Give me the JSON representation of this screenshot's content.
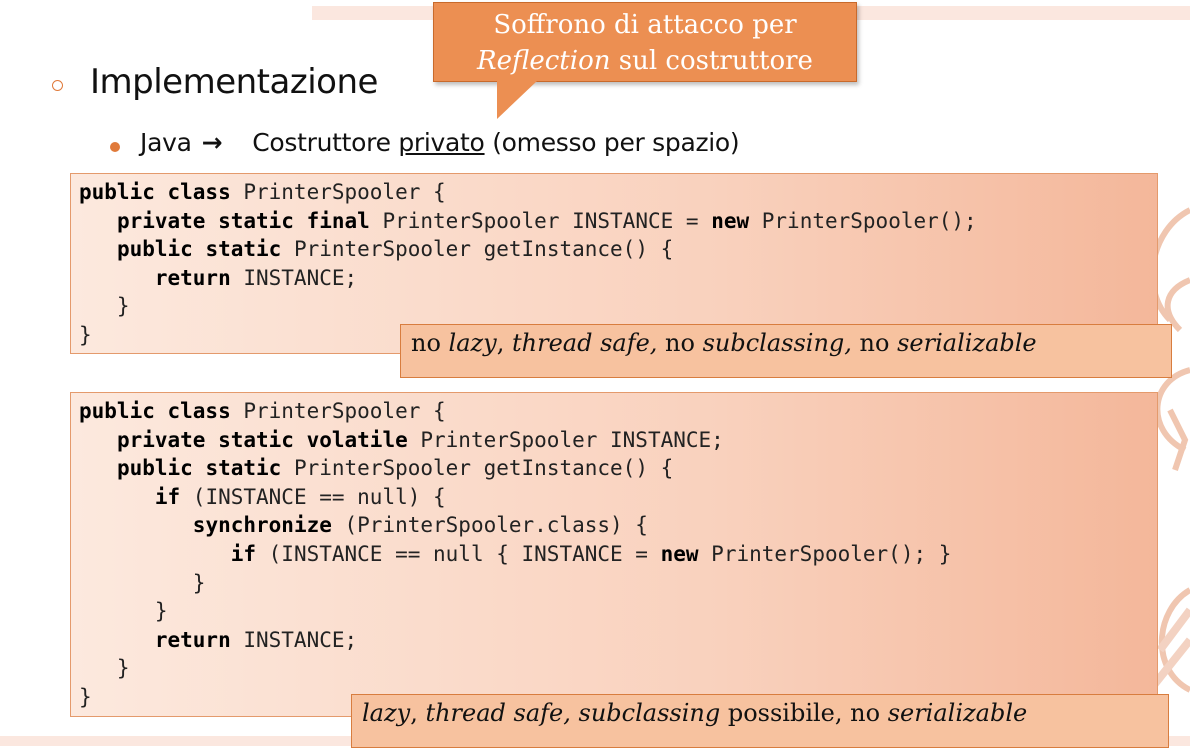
{
  "callout": {
    "line1": "Soffrono di attacco per",
    "line2_italic": "Reflection",
    "line2_rest": " sul costruttore"
  },
  "heading": "Implementazione",
  "subpoint": {
    "lang": "Java",
    "arrow": "→",
    "text_before": "Costruttore ",
    "underlined": "privato",
    "text_after": " (omesso per spazio)"
  },
  "code1": {
    "line1_kw": "public class",
    "line1_rest": " PrinterSpooler {",
    "line2_indent": "   ",
    "line2_kw": "private static final",
    "line2_mid": " PrinterSpooler INSTANCE = ",
    "line2_kw2": "new",
    "line2_rest": " PrinterSpooler();",
    "line3_indent": "   ",
    "line3_kw": "public static",
    "line3_rest": " PrinterSpooler getInstance() {",
    "line4_indent": "      ",
    "line4_kw": "return",
    "line4_rest": " INSTANCE;",
    "line5": "   }",
    "line6": "}"
  },
  "note1": {
    "p1": "no ",
    "i1": "lazy",
    "p2": ", ",
    "i2": "thread safe,",
    "p3": " no ",
    "i3": "subclassing,",
    "p4": " no ",
    "i4": "serializable"
  },
  "code2": {
    "l1_kw": "public class",
    "l1_rest": " PrinterSpooler {",
    "l2_ind": "   ",
    "l2_kw": "private static volatile",
    "l2_rest": " PrinterSpooler INSTANCE;",
    "l3_ind": "   ",
    "l3_kw": "public static",
    "l3_rest": " PrinterSpooler getInstance() {",
    "l4_ind": "      ",
    "l4_kw": "if",
    "l4_rest": " (INSTANCE == null) {",
    "l5_ind": "         ",
    "l5_kw": "synchronize",
    "l5_rest": " (PrinterSpooler.class) {",
    "l6_ind": "            ",
    "l6_kw": "if",
    "l6_mid": " (INSTANCE == null { INSTANCE = ",
    "l6_kw2": "new",
    "l6_rest": " PrinterSpooler(); }",
    "l7": "         }",
    "l8": "      }",
    "l9_ind": "      ",
    "l9_kw": "return",
    "l9_rest": " INSTANCE;",
    "l10": "   }",
    "l11": "}"
  },
  "note2": {
    "i1": "lazy",
    "p1": ", ",
    "i2": "thread safe,",
    "p2": " ",
    "i3": "subclassing",
    "p3": " possibile, no ",
    "i4": "serializable"
  },
  "colors": {
    "accent": "#e07a3a",
    "callout": "#ec8f52",
    "note_bg": "#f7c29f"
  }
}
